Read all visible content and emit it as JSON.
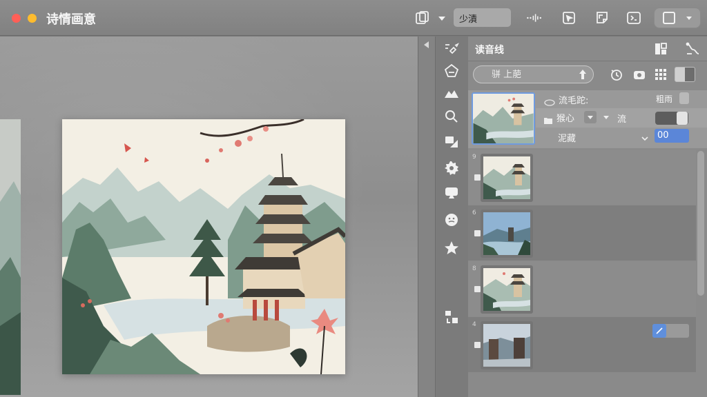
{
  "window": {
    "title": "诗情画意"
  },
  "toolbar": {
    "field_value": "少漬"
  },
  "panel": {
    "title": "读音线",
    "search_placeholder": "骈 上萉"
  },
  "selected_layer": {
    "blend_label": "流毛跎:",
    "opacity_label": "粗雨",
    "mode_label": "猴心",
    "flow_label": "流",
    "flow_value": "0",
    "fill_label": "泥藏",
    "fill_value": "00"
  },
  "layers": [
    {
      "number": "9",
      "style": "light"
    },
    {
      "number": "6",
      "style": "dark"
    },
    {
      "number": "8",
      "style": "light"
    },
    {
      "number": "4",
      "style": "dark"
    }
  ],
  "colors": {
    "accent": "#5b86d8",
    "close": "#ff5f57",
    "minimize": "#febc2e"
  }
}
